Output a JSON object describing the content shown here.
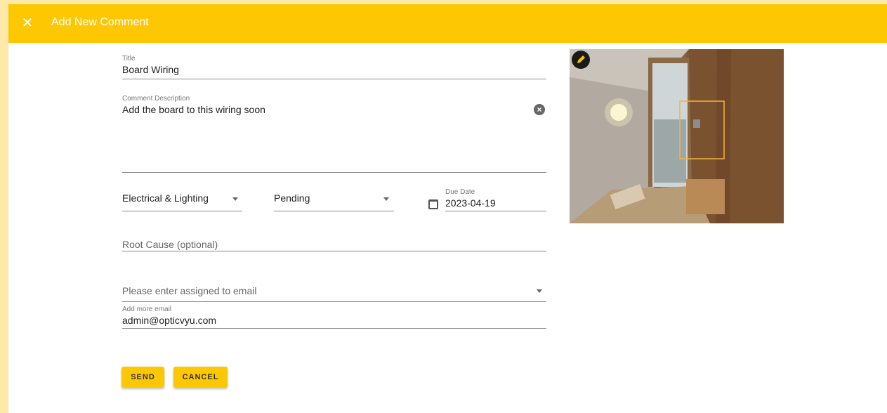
{
  "dialog": {
    "title": "Add New Comment",
    "close_icon": "close-icon"
  },
  "form": {
    "title": {
      "label": "Title",
      "value": "Board Wiring"
    },
    "description": {
      "label": "Comment Description",
      "value": "Add the board to this wiring soon"
    },
    "category": {
      "value": "Electrical & Lighting"
    },
    "status": {
      "value": "Pending"
    },
    "due_date": {
      "label": "Due Date",
      "value": "2023-04-19",
      "icon": "calendar-icon"
    },
    "root_cause": {
      "placeholder": "Root Cause (optional)"
    },
    "assigned_to": {
      "placeholder": "Please enter assigned to email"
    },
    "more_email": {
      "label": "Add more email",
      "value": "admin@opticvyu.com"
    }
  },
  "buttons": {
    "send": "SEND",
    "cancel": "CANCEL"
  },
  "image": {
    "edit_icon": "pencil-icon",
    "highlight_color": "#f2b53a"
  },
  "colors": {
    "accent": "#fec703",
    "background": "#fde9a8"
  }
}
